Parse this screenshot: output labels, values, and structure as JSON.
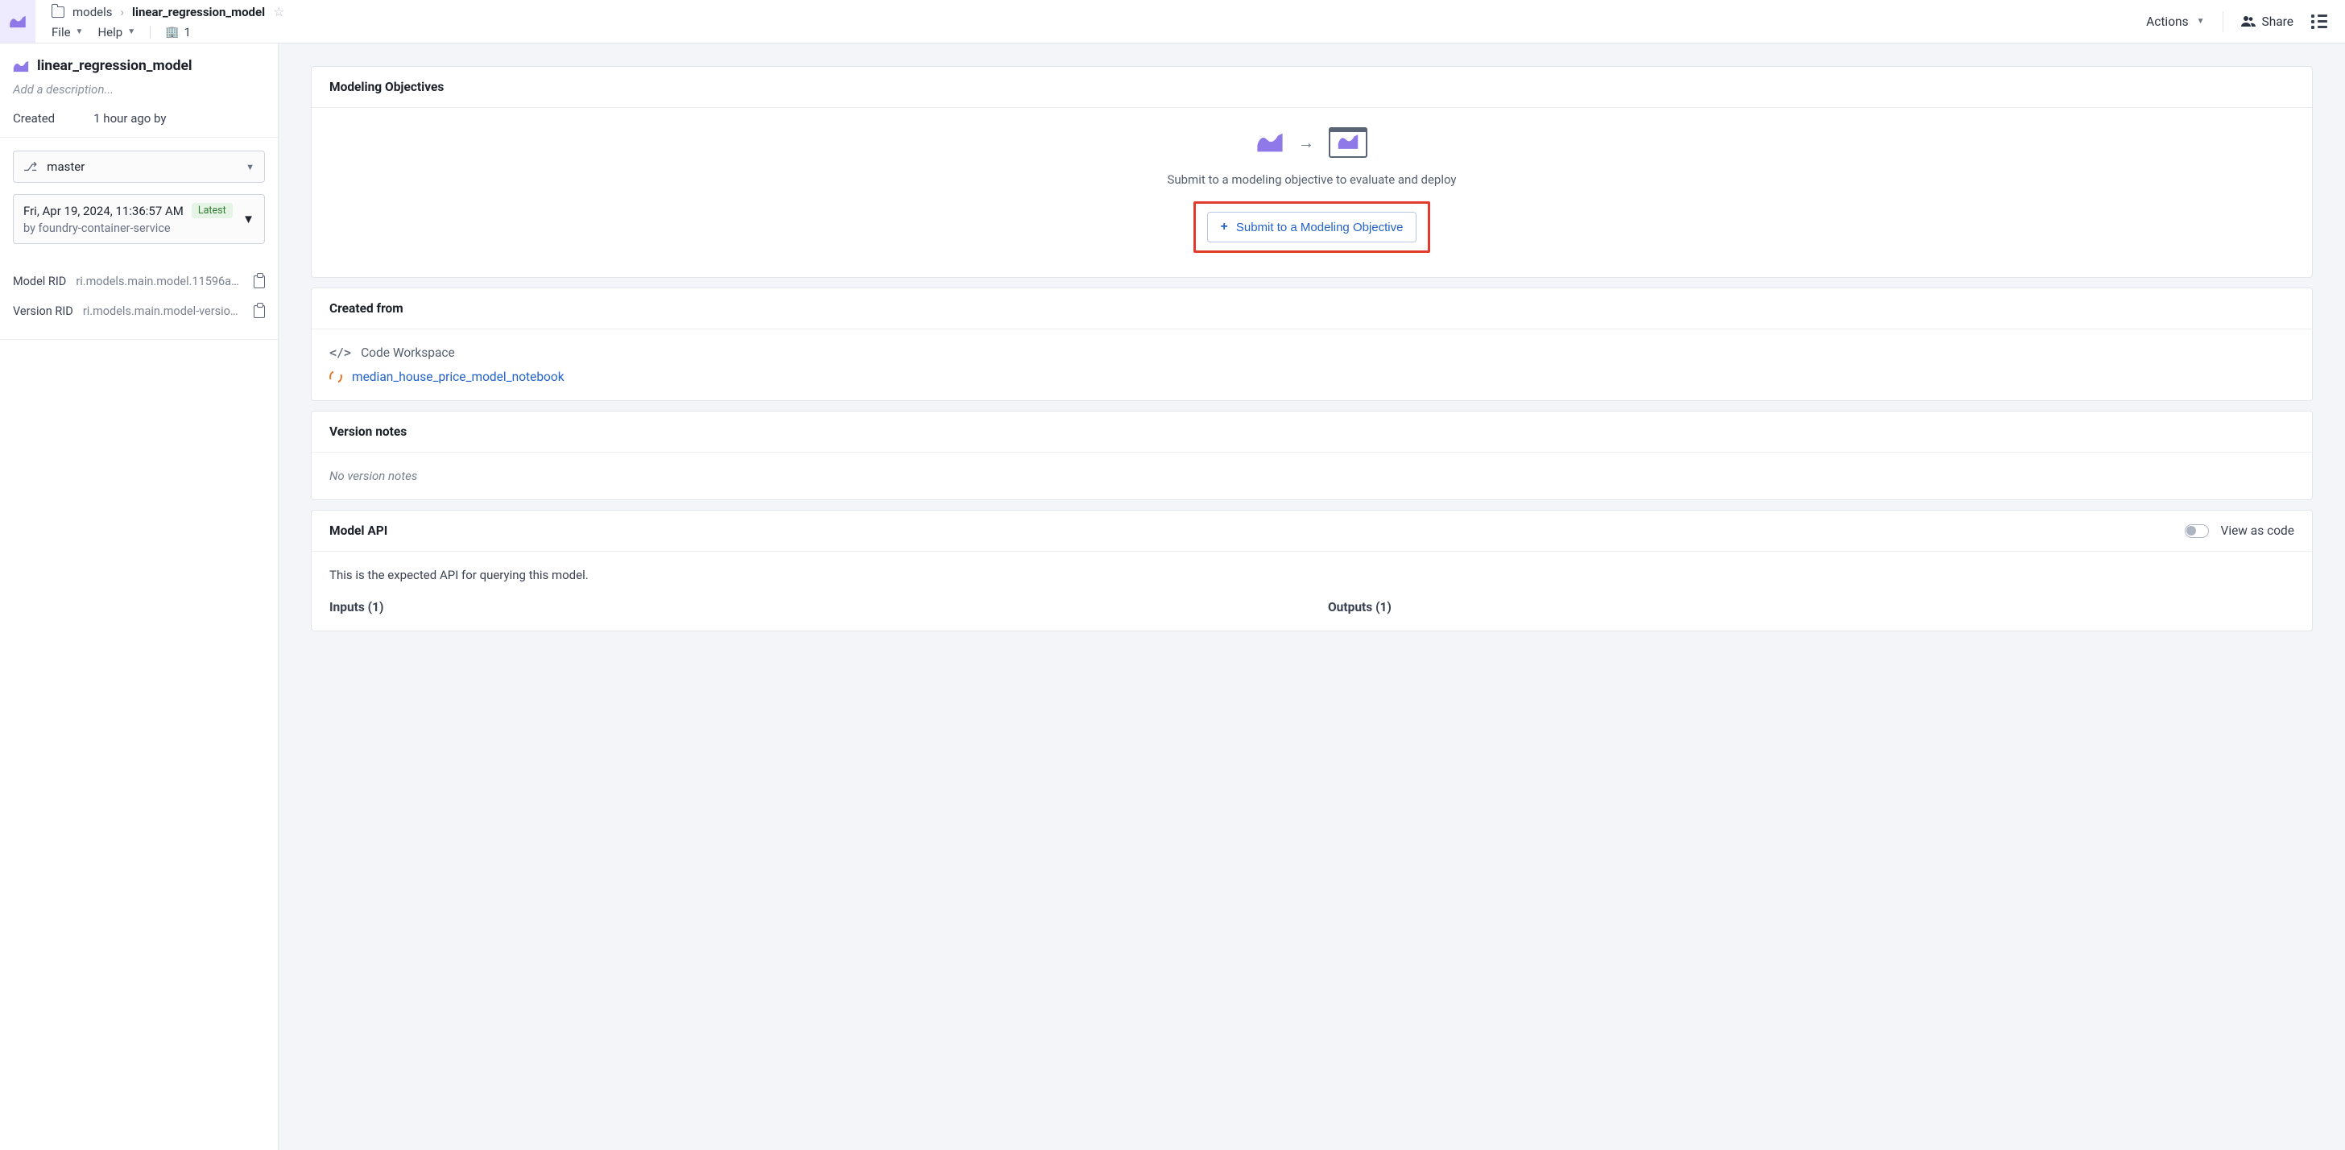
{
  "breadcrumb": {
    "parent": "models",
    "current": "linear_regression_model"
  },
  "menu": {
    "file": "File",
    "help": "Help",
    "org_count": "1"
  },
  "topbar": {
    "actions": "Actions",
    "share": "Share"
  },
  "sidebar": {
    "title": "linear_regression_model",
    "desc_placeholder": "Add a description...",
    "created_label": "Created",
    "created_value": "1 hour ago by",
    "branch": "master",
    "version_date": "Fri, Apr 19, 2024, 11:36:57 AM",
    "version_badge": "Latest",
    "version_by": "by foundry-container-service",
    "model_rid_label": "Model RID",
    "model_rid_value": "ri.models.main.model.11596a95-…",
    "version_rid_label": "Version RID",
    "version_rid_value": "ri.models.main.model-version.69…"
  },
  "panels": {
    "modeling_objectives": {
      "title": "Modeling Objectives",
      "helper": "Submit to a modeling objective to evaluate and deploy",
      "button": "Submit to a Modeling Objective"
    },
    "created_from": {
      "title": "Created from",
      "workspace_label": "Code Workspace",
      "notebook": "median_house_price_model_notebook"
    },
    "version_notes": {
      "title": "Version notes",
      "empty": "No version notes"
    },
    "model_api": {
      "title": "Model API",
      "toggle_label": "View as code",
      "desc": "This is the expected API for querying this model.",
      "inputs_label": "Inputs (1)",
      "outputs_label": "Outputs (1)"
    }
  }
}
